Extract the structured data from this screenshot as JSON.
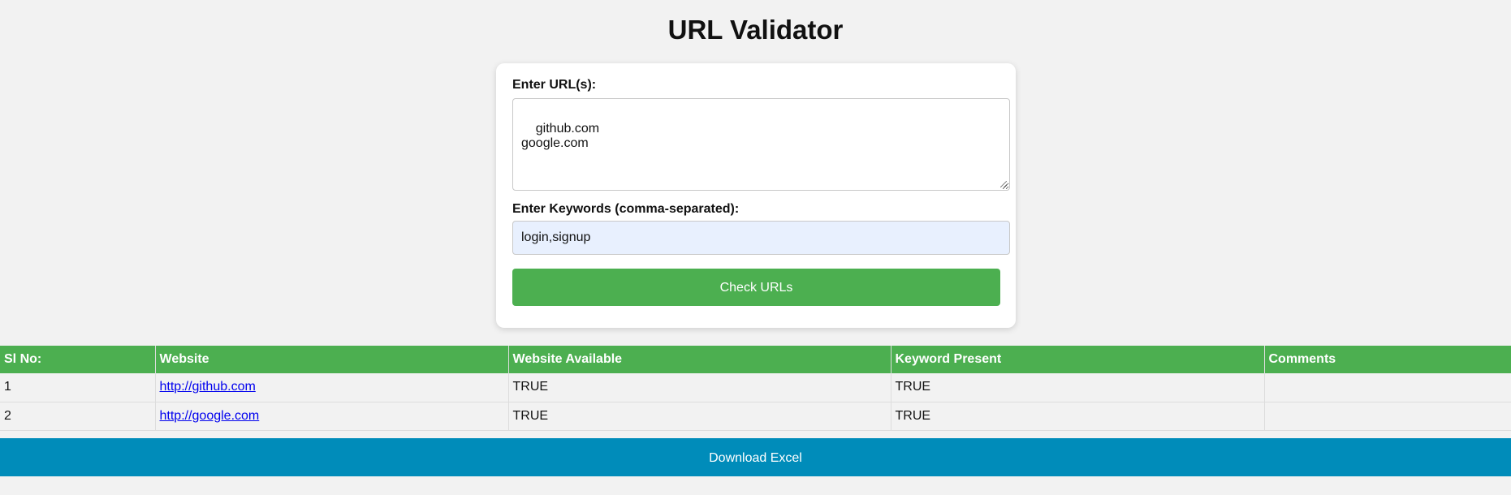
{
  "page": {
    "title": "URL Validator"
  },
  "form": {
    "urls_label": "Enter URL(s):",
    "urls_value": "github.com\ngoogle.com",
    "keywords_label": "Enter Keywords (comma-separated):",
    "keywords_value": "login,signup",
    "check_button_label": "Check URLs"
  },
  "table": {
    "headers": [
      "Sl No:",
      "Website",
      "Website Available",
      "Keyword Present",
      "Comments"
    ],
    "rows": [
      {
        "sl": "1",
        "website": "http://github.com",
        "available": "TRUE",
        "keyword": "TRUE",
        "comments": ""
      },
      {
        "sl": "2",
        "website": "http://google.com",
        "available": "TRUE",
        "keyword": "TRUE",
        "comments": ""
      }
    ]
  },
  "download_button_label": "Download Excel",
  "colors": {
    "accent_green": "#4caf50",
    "download_blue": "#008cba",
    "link_blue": "#0000ee",
    "background": "#f2f2f2",
    "autofill_bg": "#e8f0fe"
  }
}
